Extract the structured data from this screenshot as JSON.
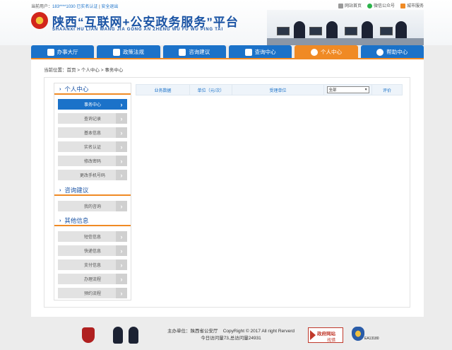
{
  "header": {
    "user_label": "当前用户：",
    "user_name": "183****1030",
    "verify_status": "已实名认证",
    "logout": "安全退出",
    "separator": "|",
    "top_links": [
      "网站首页",
      "微信公众号",
      "城市服务"
    ],
    "title": "陕西“互联网+公安政务服务”平台",
    "subtitle": "SHAANXI HU LIAN WANG JIA GONG AN ZHENG WU FU WU PING TAI"
  },
  "nav": {
    "items": [
      {
        "label": "办事大厅",
        "icon": "home-icon"
      },
      {
        "label": "政策法规",
        "icon": "book-icon"
      },
      {
        "label": "咨询建议",
        "icon": "chat-icon"
      },
      {
        "label": "查询中心",
        "icon": "search-doc-icon"
      },
      {
        "label": "个人中心",
        "icon": "person-icon",
        "active": true
      },
      {
        "label": "帮助中心",
        "icon": "help-icon"
      }
    ]
  },
  "breadcrumb": "当前位置：首页 > 个人中心 > 事务中心",
  "sidebar": {
    "sections": [
      {
        "title": "个人中心",
        "items": [
          {
            "label": "事务中心",
            "active": true
          },
          {
            "label": "查询记录"
          },
          {
            "label": "基本信息"
          },
          {
            "label": "实名认证"
          },
          {
            "label": "修改密码"
          },
          {
            "label": "更改手机号码"
          }
        ]
      },
      {
        "title": "咨询建议",
        "items": [
          {
            "label": "我的咨询"
          }
        ]
      },
      {
        "title": "其他信息",
        "items": [
          {
            "label": "短信信息"
          },
          {
            "label": "快递信息"
          },
          {
            "label": "支付信息"
          },
          {
            "label": "办理流程"
          },
          {
            "label": "预约流程"
          }
        ]
      }
    ]
  },
  "table": {
    "columns": [
      "业务数据",
      "单位（元/次）",
      "受理单位",
      "全部",
      "评价"
    ],
    "filter_selected": "全部"
  },
  "footer": {
    "host": "主办单位：陕西省公安厅",
    "copyright": "CopyRight © 2017 All right Rerverd",
    "visits": "今日访问量73,总访问量24931",
    "gov_badge_title": "政府网站",
    "gov_badge_sub": "找错",
    "police_badge_code": "EA13180"
  },
  "colors": {
    "brand_blue": "#1b72c9",
    "accent_orange": "#f08a24"
  }
}
